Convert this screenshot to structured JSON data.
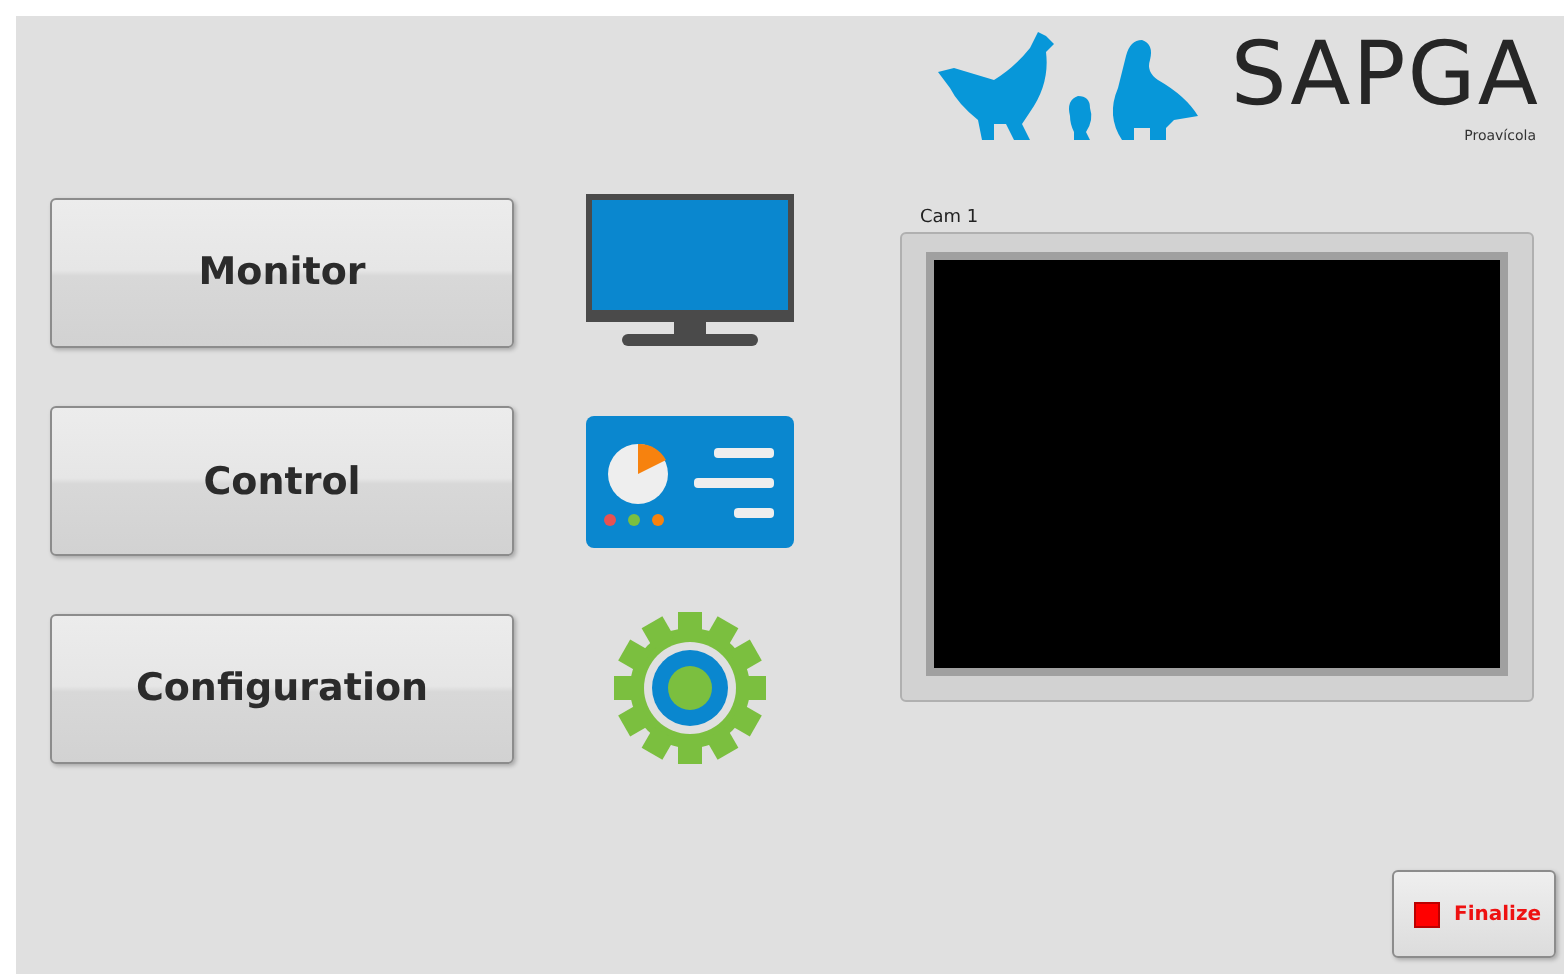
{
  "logo": {
    "title": "SAPGA",
    "subtitle": "Proavícola"
  },
  "menu": [
    {
      "label": "Monitor",
      "kind": "monitor"
    },
    {
      "label": "Control",
      "kind": "dashboard"
    },
    {
      "label": "Configuration",
      "kind": "gear"
    }
  ],
  "camera": {
    "label": "Cam 1"
  },
  "finalize_button": {
    "label": "Finalize"
  }
}
